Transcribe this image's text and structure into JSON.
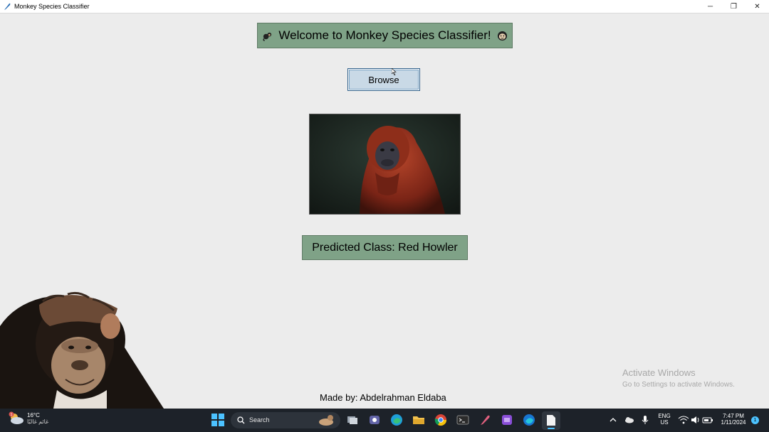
{
  "window": {
    "title": "Monkey Species Classifier",
    "minimize_glyph": "─",
    "restore_glyph": "❐",
    "close_glyph": "✕"
  },
  "main": {
    "welcome": "Welcome to Monkey Species Classifier!",
    "browse_label": "Browse",
    "prediction": "Predicted Class: Red Howler",
    "credit": "Made by: Abdelrahman Eldaba"
  },
  "watermark": {
    "title": "Activate Windows",
    "subtitle": "Go to Settings to activate Windows."
  },
  "taskbar": {
    "weather_temp": "16°C",
    "weather_condition": "غائم غالبًا",
    "search_placeholder": "Search",
    "language": "ENG",
    "region": "US",
    "time": "7:47 PM",
    "date": "1/11/2024",
    "notification_count": "1"
  },
  "colors": {
    "label_green": "#7fa287",
    "browse_blue": "#c9d9e6",
    "taskbar": "#1d2229"
  },
  "icons": [
    "monkey-emoji-icon",
    "monkey-face-icon",
    "windows-start-icon",
    "search-icon",
    "edge-icon",
    "file-explorer-icon",
    "chrome-icon",
    "terminal-icon",
    "wifi-icon",
    "volume-icon",
    "battery-icon"
  ]
}
